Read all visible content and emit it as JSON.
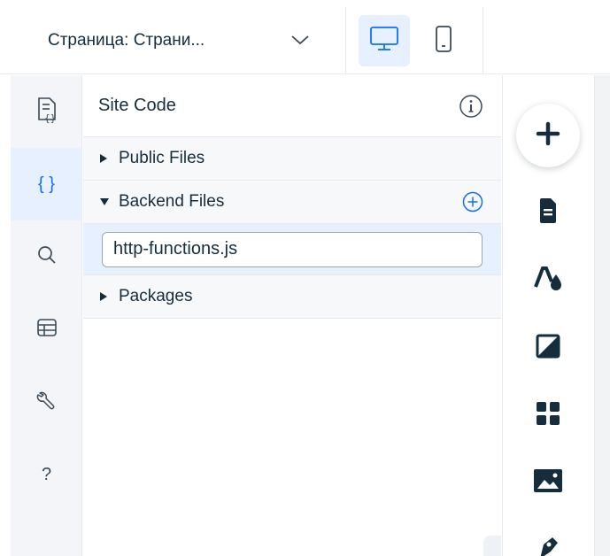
{
  "topbar": {
    "page_label_prefix": "Страница:",
    "page_label_value": "Страни...",
    "device_desktop": "desktop-icon",
    "device_mobile": "mobile-icon"
  },
  "rail": {
    "items": [
      {
        "icon": "page-code-icon"
      },
      {
        "icon": "curly-braces-icon",
        "glyph": "{ }"
      },
      {
        "icon": "search-icon"
      },
      {
        "icon": "database-table-icon"
      },
      {
        "icon": "wrench-icon"
      },
      {
        "icon": "help-icon",
        "glyph": "?"
      }
    ]
  },
  "panel": {
    "title": "Site Code",
    "sections": {
      "public": "Public Files",
      "backend": "Backend Files",
      "packages": "Packages"
    },
    "file_value": "http-functions.js"
  },
  "colors": {
    "accent": "#116dff",
    "accent_bg": "#e7f0ff",
    "text": "#162d3d"
  }
}
